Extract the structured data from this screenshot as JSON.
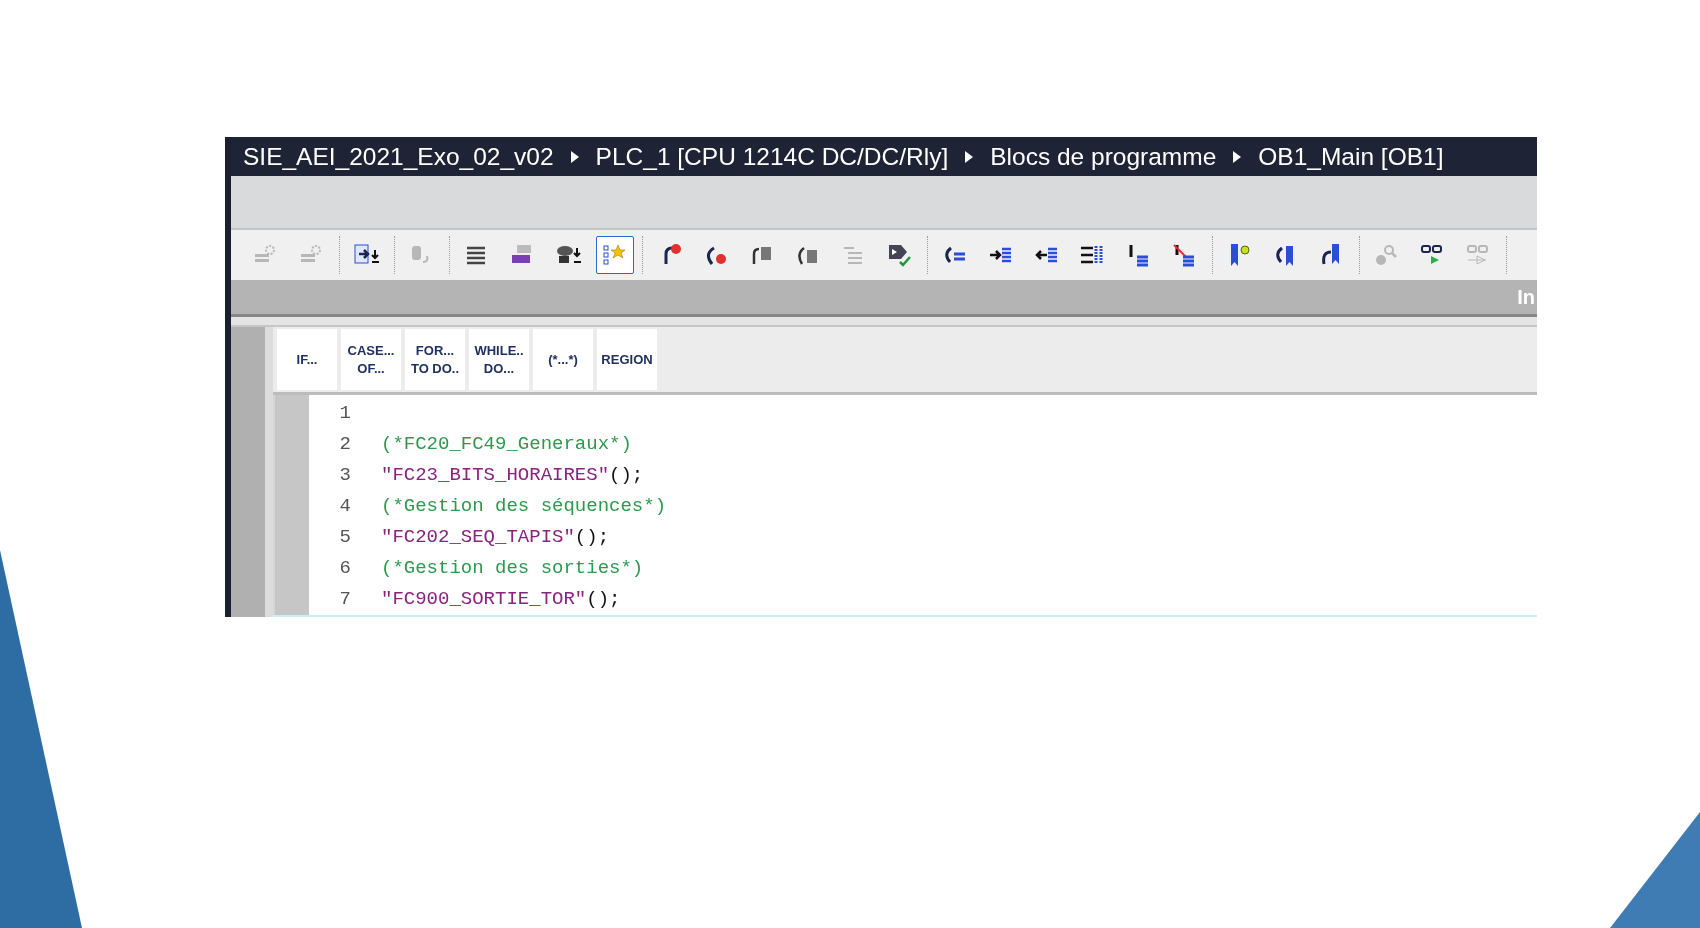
{
  "breadcrumb": [
    "SIE_AEI_2021_Exo_02_v02",
    "PLC_1 [CPU 1214C DC/DC/Rly]",
    "Blocs de programme",
    "OB1_Main [OB1]"
  ],
  "toolbar": {
    "groups": [
      [
        {
          "disabled": true,
          "selected": false
        },
        {
          "disabled": true,
          "selected": false
        }
      ],
      [
        {
          "disabled": false,
          "selected": false
        }
      ],
      [
        {
          "disabled": true,
          "selected": false
        }
      ],
      [
        {
          "disabled": false,
          "selected": false
        },
        {
          "disabled": false,
          "selected": false
        },
        {
          "disabled": false,
          "selected": false
        },
        {
          "disabled": false,
          "selected": true
        }
      ],
      [
        {
          "disabled": false,
          "selected": false
        },
        {
          "disabled": false,
          "selected": false
        },
        {
          "disabled": false,
          "selected": false
        },
        {
          "disabled": false,
          "selected": false
        },
        {
          "disabled": true,
          "selected": false
        },
        {
          "disabled": false,
          "selected": false
        }
      ],
      [
        {
          "disabled": false,
          "selected": false
        },
        {
          "disabled": false,
          "selected": false
        },
        {
          "disabled": false,
          "selected": false
        },
        {
          "disabled": false,
          "selected": false
        },
        {
          "disabled": false,
          "selected": false
        },
        {
          "disabled": false,
          "selected": false
        }
      ],
      [
        {
          "disabled": false,
          "selected": false
        },
        {
          "disabled": false,
          "selected": false
        },
        {
          "disabled": false,
          "selected": false
        }
      ],
      [
        {
          "disabled": true,
          "selected": false
        },
        {
          "disabled": false,
          "selected": false
        },
        {
          "disabled": true,
          "selected": false
        }
      ]
    ]
  },
  "panel_label": "In",
  "snippets": [
    {
      "lines": [
        "IF..."
      ]
    },
    {
      "lines": [
        "CASE...",
        "OF..."
      ]
    },
    {
      "lines": [
        "FOR...",
        "TO DO.."
      ]
    },
    {
      "lines": [
        "WHILE..",
        "DO..."
      ]
    },
    {
      "lines": [
        "(*...*)"
      ]
    },
    {
      "lines": [
        "REGION"
      ]
    }
  ],
  "code": [
    {
      "number": "1",
      "kind": "blank"
    },
    {
      "number": "2",
      "kind": "comment",
      "text": "(*FC20_FC49_Generaux*)"
    },
    {
      "number": "3",
      "kind": "call",
      "name": "\"FC23_BITS_HORAIRES\"",
      "args": "();"
    },
    {
      "number": "4",
      "kind": "comment",
      "text": "(*Gestion des séquences*)"
    },
    {
      "number": "5",
      "kind": "call",
      "name": "\"FC202_SEQ_TAPIS\"",
      "args": "();"
    },
    {
      "number": "6",
      "kind": "comment",
      "text": "(*Gestion des sorties*)"
    },
    {
      "number": "7",
      "kind": "call",
      "name": "\"FC900_SORTIE_TOR\"",
      "args": "();"
    }
  ]
}
